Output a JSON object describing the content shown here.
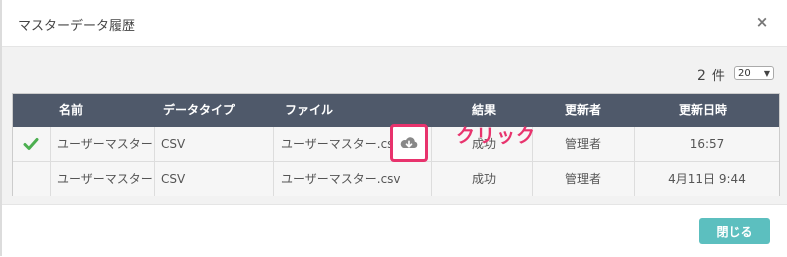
{
  "modal": {
    "title": "マスターデータ履歴",
    "close_symbol": "×"
  },
  "pagination": {
    "count": "2",
    "count_unit": "件",
    "per_page": "20"
  },
  "table": {
    "headers": [
      "名前",
      "データタイプ",
      "ファイル",
      "結果",
      "更新者",
      "更新日時"
    ],
    "rows": [
      {
        "status_icon": "check-icon",
        "name": "ユーザーマスター",
        "type": "CSV",
        "file": "ユーザーマスター.csv",
        "result": "成功",
        "updater": "管理者",
        "datetime": "16:57"
      },
      {
        "name": "ユーザーマスター",
        "type": "CSV",
        "file": "ユーザーマスター.csv",
        "result": "成功",
        "updater": "管理者",
        "datetime": "4月11日 9:44"
      }
    ]
  },
  "annotation": {
    "text": "クリック",
    "color": "#e8336d",
    "icon": "cloud-download-icon"
  },
  "footer": {
    "close_label": "閉じる",
    "accent": "#5cbfbf"
  },
  "colors": {
    "header_bg": "#4f596a",
    "check": "#4caf50"
  }
}
